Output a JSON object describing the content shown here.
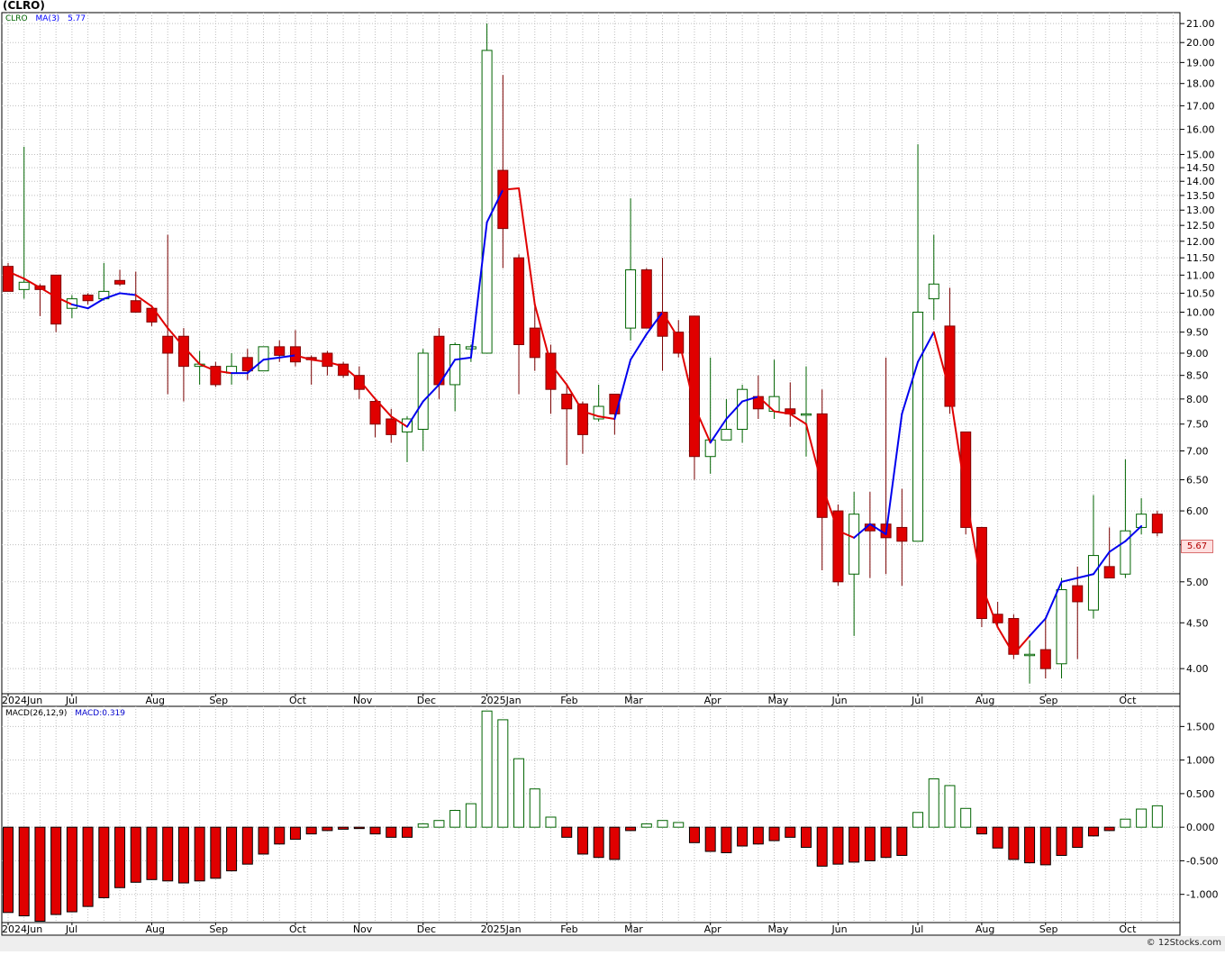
{
  "chart_data": [
    {
      "type": "candlestick",
      "title": "(CLRO)",
      "legend": [
        {
          "label": "CLRO",
          "color": "#006400"
        },
        {
          "label": "MA(3)",
          "color": "#0000ff"
        },
        {
          "label": "5.77",
          "color": "#0000ff"
        }
      ],
      "last_price_label": "5.67",
      "y_scale": "log",
      "ylim": [
        3.75,
        21.6
      ],
      "y_ticks": [
        "4.00",
        "4.50",
        "5.00",
        "5.50",
        "6.00",
        "6.50",
        "7.00",
        "7.50",
        "8.00",
        "8.50",
        "9.00",
        "9.50",
        "10.00",
        "10.50",
        "11.00",
        "11.50",
        "12.00",
        "12.50",
        "13.00",
        "13.50",
        "14.00",
        "14.50",
        "15.00",
        "16.00",
        "17.00",
        "18.00",
        "19.00",
        "20.00",
        "21.00"
      ],
      "x_labels": [
        "2024Jun",
        "Jul",
        "Aug",
        "Sep",
        "Oct",
        "Nov",
        "Dec",
        "2025Jan",
        "Feb",
        "Mar",
        "Apr",
        "May",
        "Jun",
        "Jul",
        "Aug",
        "Sep",
        "Oct"
      ],
      "x_label_weeks": [
        0,
        4,
        9,
        13,
        18,
        22,
        26,
        30,
        35,
        39,
        44,
        48,
        52,
        57,
        61,
        65,
        70
      ],
      "candles": [
        {
          "o": 11.25,
          "h": 11.35,
          "l": 10.55,
          "c": 10.55
        },
        {
          "o": 10.6,
          "h": 15.3,
          "l": 10.35,
          "c": 10.8
        },
        {
          "o": 10.7,
          "h": 10.75,
          "l": 9.9,
          "c": 10.6
        },
        {
          "o": 11.0,
          "h": 11.0,
          "l": 9.5,
          "c": 9.7
        },
        {
          "o": 10.1,
          "h": 10.45,
          "l": 9.85,
          "c": 10.35
        },
        {
          "o": 10.45,
          "h": 10.5,
          "l": 10.2,
          "c": 10.3
        },
        {
          "o": 10.35,
          "h": 11.35,
          "l": 10.3,
          "c": 10.55
        },
        {
          "o": 10.85,
          "h": 11.15,
          "l": 10.7,
          "c": 10.75
        },
        {
          "o": 10.3,
          "h": 11.1,
          "l": 10.0,
          "c": 10.0
        },
        {
          "o": 10.1,
          "h": 10.15,
          "l": 9.65,
          "c": 9.75
        },
        {
          "o": 9.4,
          "h": 12.2,
          "l": 8.1,
          "c": 9.0
        },
        {
          "o": 9.4,
          "h": 9.6,
          "l": 7.95,
          "c": 8.7
        },
        {
          "o": 8.7,
          "h": 9.05,
          "l": 8.3,
          "c": 8.75
        },
        {
          "o": 8.7,
          "h": 8.8,
          "l": 8.25,
          "c": 8.3
        },
        {
          "o": 8.55,
          "h": 9.0,
          "l": 8.3,
          "c": 8.7
        },
        {
          "o": 8.9,
          "h": 9.1,
          "l": 8.4,
          "c": 8.6
        },
        {
          "o": 8.6,
          "h": 9.15,
          "l": 8.6,
          "c": 9.15
        },
        {
          "o": 9.15,
          "h": 9.3,
          "l": 8.8,
          "c": 8.95
        },
        {
          "o": 9.15,
          "h": 9.55,
          "l": 8.7,
          "c": 8.8
        },
        {
          "o": 8.9,
          "h": 8.95,
          "l": 8.3,
          "c": 8.85
        },
        {
          "o": 9.0,
          "h": 9.05,
          "l": 8.5,
          "c": 8.7
        },
        {
          "o": 8.75,
          "h": 8.8,
          "l": 8.45,
          "c": 8.5
        },
        {
          "o": 8.5,
          "h": 8.7,
          "l": 8.0,
          "c": 8.2
        },
        {
          "o": 7.95,
          "h": 8.0,
          "l": 7.25,
          "c": 7.5
        },
        {
          "o": 7.6,
          "h": 7.8,
          "l": 7.15,
          "c": 7.3
        },
        {
          "o": 7.35,
          "h": 7.65,
          "l": 6.8,
          "c": 7.6
        },
        {
          "o": 7.4,
          "h": 9.1,
          "l": 7.0,
          "c": 9.0
        },
        {
          "o": 9.4,
          "h": 9.6,
          "l": 8.0,
          "c": 8.3
        },
        {
          "o": 8.3,
          "h": 9.25,
          "l": 7.75,
          "c": 9.2
        },
        {
          "o": 9.1,
          "h": 9.2,
          "l": 8.8,
          "c": 9.15
        },
        {
          "o": 9.0,
          "h": 21.0,
          "l": 9.0,
          "c": 19.6
        },
        {
          "o": 14.4,
          "h": 18.4,
          "l": 11.2,
          "c": 12.4
        },
        {
          "o": 11.5,
          "h": 11.6,
          "l": 8.1,
          "c": 9.2
        },
        {
          "o": 9.6,
          "h": 10.2,
          "l": 8.6,
          "c": 8.9
        },
        {
          "o": 9.0,
          "h": 9.2,
          "l": 7.7,
          "c": 8.2
        },
        {
          "o": 8.1,
          "h": 8.3,
          "l": 6.75,
          "c": 7.8
        },
        {
          "o": 7.9,
          "h": 7.95,
          "l": 6.95,
          "c": 7.3
        },
        {
          "o": 7.6,
          "h": 8.3,
          "l": 7.55,
          "c": 7.85
        },
        {
          "o": 8.1,
          "h": 8.1,
          "l": 7.3,
          "c": 7.7
        },
        {
          "o": 9.6,
          "h": 13.4,
          "l": 9.3,
          "c": 11.15
        },
        {
          "o": 11.15,
          "h": 11.2,
          "l": 9.6,
          "c": 9.6
        },
        {
          "o": 10.0,
          "h": 11.5,
          "l": 8.6,
          "c": 9.4
        },
        {
          "o": 9.5,
          "h": 9.8,
          "l": 8.9,
          "c": 9.0
        },
        {
          "o": 9.9,
          "h": 9.9,
          "l": 6.5,
          "c": 6.9
        },
        {
          "o": 6.9,
          "h": 8.9,
          "l": 6.6,
          "c": 7.2
        },
        {
          "o": 7.2,
          "h": 8.0,
          "l": 7.2,
          "c": 7.4
        },
        {
          "o": 7.4,
          "h": 8.3,
          "l": 7.15,
          "c": 8.2
        },
        {
          "o": 8.05,
          "h": 8.5,
          "l": 7.6,
          "c": 7.8
        },
        {
          "o": 7.75,
          "h": 8.85,
          "l": 7.6,
          "c": 8.05
        },
        {
          "o": 7.8,
          "h": 8.35,
          "l": 7.45,
          "c": 7.7
        },
        {
          "o": 7.7,
          "h": 8.7,
          "l": 6.9,
          "c": 7.7
        },
        {
          "o": 7.7,
          "h": 8.2,
          "l": 5.15,
          "c": 5.9
        },
        {
          "o": 6.0,
          "h": 6.1,
          "l": 4.95,
          "c": 5.0
        },
        {
          "o": 5.1,
          "h": 6.3,
          "l": 4.35,
          "c": 5.95
        },
        {
          "o": 5.8,
          "h": 6.3,
          "l": 5.05,
          "c": 5.7
        },
        {
          "o": 5.8,
          "h": 8.9,
          "l": 5.1,
          "c": 5.6
        },
        {
          "o": 5.75,
          "h": 6.35,
          "l": 4.95,
          "c": 5.55
        },
        {
          "o": 5.55,
          "h": 15.4,
          "l": 5.55,
          "c": 10.0
        },
        {
          "o": 10.35,
          "h": 12.2,
          "l": 9.8,
          "c": 10.75
        },
        {
          "o": 9.65,
          "h": 10.65,
          "l": 7.7,
          "c": 7.85
        },
        {
          "o": 7.35,
          "h": 7.35,
          "l": 5.65,
          "c": 5.75
        },
        {
          "o": 5.75,
          "h": 5.75,
          "l": 4.45,
          "c": 4.55
        },
        {
          "o": 4.6,
          "h": 4.75,
          "l": 4.45,
          "c": 4.5
        },
        {
          "o": 4.55,
          "h": 4.6,
          "l": 4.1,
          "c": 4.15
        },
        {
          "o": 4.15,
          "h": 4.3,
          "l": 3.85,
          "c": 4.15
        },
        {
          "o": 4.2,
          "h": 4.55,
          "l": 3.9,
          "c": 4.0
        },
        {
          "o": 4.05,
          "h": 5.05,
          "l": 3.9,
          "c": 4.9
        },
        {
          "o": 4.95,
          "h": 5.2,
          "l": 4.1,
          "c": 4.75
        },
        {
          "o": 4.65,
          "h": 6.25,
          "l": 4.55,
          "c": 5.35
        },
        {
          "o": 5.2,
          "h": 5.75,
          "l": 5.05,
          "c": 5.05
        },
        {
          "o": 5.1,
          "h": 6.85,
          "l": 5.05,
          "c": 5.7
        },
        {
          "o": 5.75,
          "h": 6.2,
          "l": 5.65,
          "c": 5.95
        },
        {
          "o": 5.95,
          "h": 6.0,
          "l": 5.62,
          "c": 5.67
        }
      ],
      "ma3": [
        11.1,
        10.9,
        10.65,
        10.4,
        10.2,
        10.1,
        10.35,
        10.5,
        10.45,
        10.15,
        9.6,
        9.15,
        8.75,
        8.6,
        8.55,
        8.55,
        8.85,
        8.9,
        8.95,
        8.85,
        8.8,
        8.7,
        8.4,
        8.0,
        7.65,
        7.45,
        7.95,
        8.3,
        8.85,
        8.9,
        12.6,
        13.7,
        13.75,
        10.2,
        8.75,
        8.3,
        7.75,
        7.65,
        7.6,
        8.85,
        9.45,
        10.0,
        9.35,
        7.85,
        7.15,
        7.6,
        7.95,
        8.05,
        7.75,
        7.7,
        7.5,
        6.4,
        5.7,
        5.6,
        5.8,
        5.65,
        7.7,
        8.8,
        9.5,
        8.15,
        6.25,
        4.95,
        4.45,
        4.15,
        4.35,
        4.55,
        5.0,
        5.05,
        5.1,
        5.4,
        5.55,
        5.77
      ],
      "ma3_colors": [
        "#e00000",
        "#e00000",
        "#e00000",
        "#e00000",
        "#0000ee",
        "#0000ee",
        "#0000ee",
        "#0000ee",
        "#e00000",
        "#e00000",
        "#e00000",
        "#e00000",
        "#e00000",
        "#e00000",
        "#0000ee",
        "#0000ee",
        "#0000ee",
        "#0000ee",
        "#e00000",
        "#e00000",
        "#e00000",
        "#e00000",
        "#e00000",
        "#e00000",
        "#e00000",
        "#0000ee",
        "#0000ee",
        "#0000ee",
        "#0000ee",
        "#0000ee",
        "#0000ee",
        "#e00000",
        "#e00000",
        "#e00000",
        "#e00000",
        "#e00000",
        "#e00000",
        "#e00000",
        "#0000ee",
        "#0000ee",
        "#0000ee",
        "#e00000",
        "#e00000",
        "#e00000",
        "#0000ee",
        "#0000ee",
        "#0000ee",
        "#e00000",
        "#e00000",
        "#e00000",
        "#e00000",
        "#e00000",
        "#e00000",
        "#0000ee",
        "#0000ee",
        "#0000ee",
        "#0000ee",
        "#0000ee",
        "#e00000",
        "#e00000",
        "#e00000",
        "#e00000",
        "#e00000",
        "#e00000",
        "#0000ee",
        "#0000ee",
        "#0000ee",
        "#0000ee",
        "#0000ee",
        "#0000ee",
        "#0000ee"
      ]
    },
    {
      "type": "bar",
      "legend": [
        {
          "label": "MACD(26,12,9)",
          "color": "#000000"
        },
        {
          "label": "MACD:0.319",
          "color": "#0000cc"
        }
      ],
      "ylim": [
        -1.42,
        1.8
      ],
      "y_ticks": [
        "1.500",
        "1.000",
        "0.500",
        "0.000",
        "-0.500",
        "-1.000"
      ],
      "x_labels": [
        "2024Jun",
        "Jul",
        "Aug",
        "Sep",
        "Oct",
        "Nov",
        "Dec",
        "2025Jan",
        "Feb",
        "Mar",
        "Apr",
        "May",
        "Jun",
        "Jul",
        "Aug",
        "Sep",
        "Oct"
      ],
      "values": [
        -1.27,
        -1.32,
        -1.4,
        -1.3,
        -1.26,
        -1.18,
        -1.05,
        -0.9,
        -0.82,
        -0.78,
        -0.8,
        -0.83,
        -0.8,
        -0.76,
        -0.65,
        -0.55,
        -0.4,
        -0.25,
        -0.18,
        -0.1,
        -0.05,
        -0.03,
        -0.02,
        -0.1,
        -0.15,
        -0.15,
        0.05,
        0.1,
        0.25,
        0.35,
        1.73,
        1.6,
        1.02,
        0.57,
        0.15,
        -0.15,
        -0.4,
        -0.45,
        -0.48,
        -0.05,
        0.05,
        0.1,
        0.07,
        -0.23,
        -0.36,
        -0.38,
        -0.28,
        -0.25,
        -0.2,
        -0.15,
        -0.3,
        -0.58,
        -0.55,
        -0.52,
        -0.5,
        -0.45,
        -0.42,
        0.22,
        0.72,
        0.62,
        0.28,
        -0.1,
        -0.31,
        -0.48,
        -0.53,
        -0.56,
        -0.42,
        -0.3,
        -0.13,
        -0.05,
        0.12,
        0.27,
        0.319
      ],
      "colors": [
        "#e00000",
        "#e00000",
        "#e00000",
        "#e00000",
        "#e00000",
        "#e00000",
        "#e00000",
        "#e00000",
        "#e00000",
        "#e00000",
        "#e00000",
        "#e00000",
        "#e00000",
        "#e00000",
        "#e00000",
        "#e00000",
        "#e00000",
        "#e00000",
        "#e00000",
        "#e00000",
        "#e00000",
        "#e00000",
        "#e00000",
        "#e00000",
        "#e00000",
        "#e00000",
        "#006400",
        "#006400",
        "#006400",
        "#006400",
        "#006400",
        "#006400",
        "#006400",
        "#006400",
        "#006400",
        "#e00000",
        "#e00000",
        "#e00000",
        "#e00000",
        "#e00000",
        "#006400",
        "#006400",
        "#006400",
        "#e00000",
        "#e00000",
        "#e00000",
        "#e00000",
        "#e00000",
        "#e00000",
        "#e00000",
        "#e00000",
        "#e00000",
        "#e00000",
        "#e00000",
        "#e00000",
        "#e00000",
        "#e00000",
        "#006400",
        "#006400",
        "#006400",
        "#006400",
        "#e00000",
        "#e00000",
        "#e00000",
        "#e00000",
        "#e00000",
        "#e00000",
        "#e00000",
        "#e00000",
        "#e00000",
        "#006400",
        "#006400",
        "#006400"
      ]
    }
  ],
  "copyright": "© 12Stocks.com",
  "colors": {
    "up_outline": "#006400",
    "down_fill": "#e00000",
    "ma_up": "#0000ee",
    "ma_down": "#e00000",
    "grid": "#bfbfbf"
  }
}
